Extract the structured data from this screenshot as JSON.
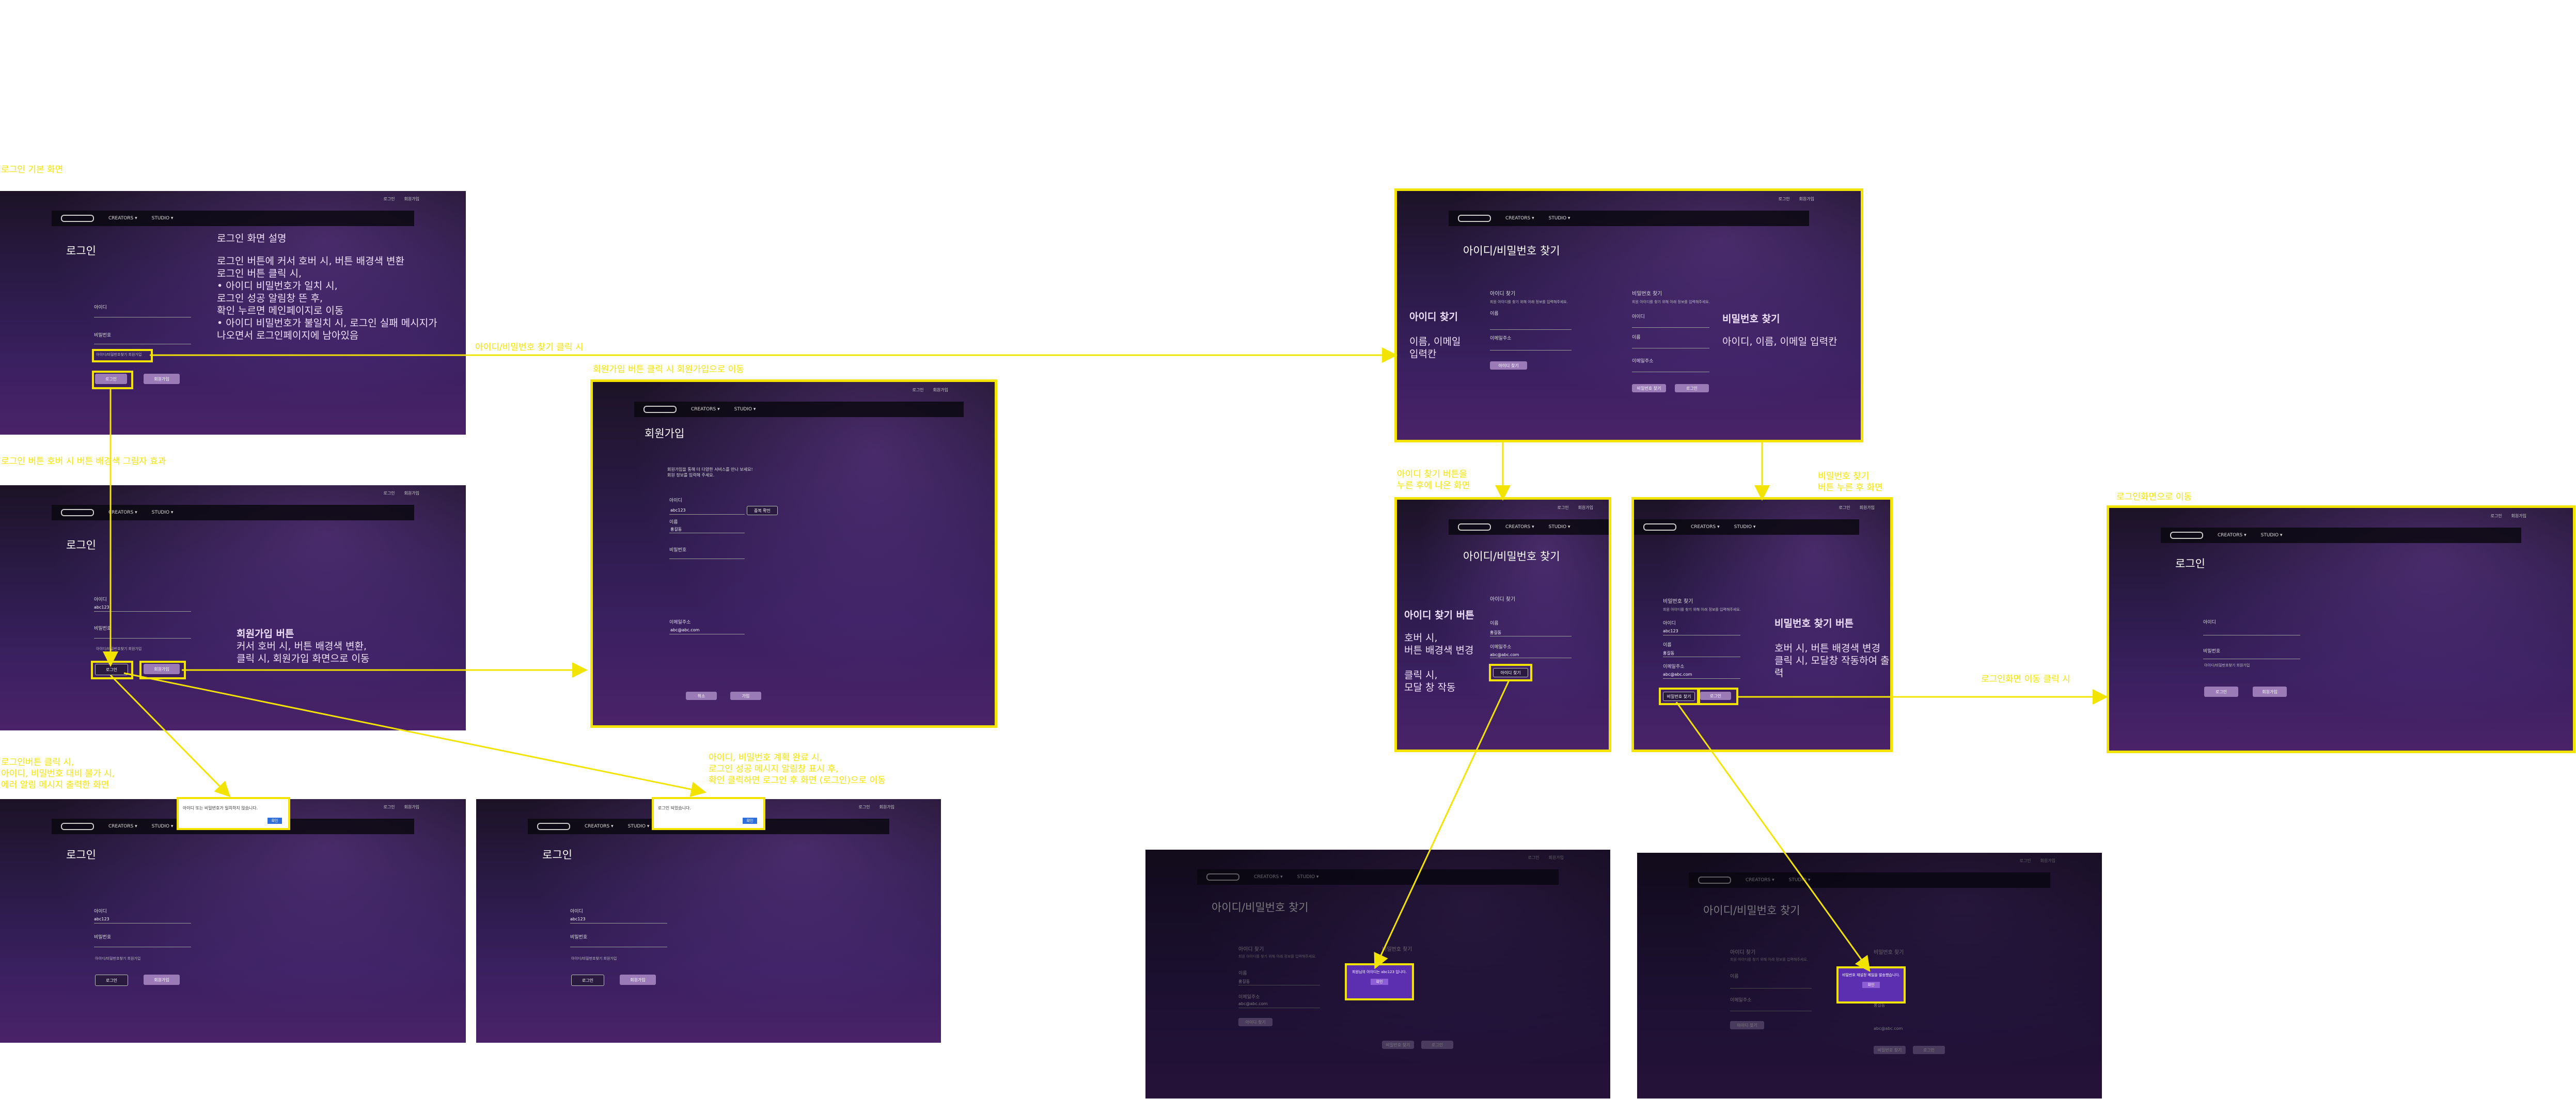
{
  "notes": {
    "login_default": "로그인 기본 화면",
    "login_hover": "로그인 버튼 호버 시 버튼 배경색 그림자 효과",
    "find_click": "아이디/비밀번호 찾기 클릭 시",
    "signup_click": "회원가입 버튼 클릭 시 회원가입으로 이동",
    "login_fail": "로그인버튼 클릭 시,\n아이디, 비밀번호 대비 불가 시,\n에러 알림 메시지 출력한 화면",
    "login_success": "아이디, 비밀번호 계획 완료 시,\n로그인 성공 메시지 알림창 표시 후,\n확인 클릭하면 로그인 후 화면 (로그인)으로 이동",
    "find_id_hover": "아이디 찾기 버튼을\n누른 후에 나온 화면",
    "find_pw_hover": "비밀번호 찾기\n버튼 누른 후 화면",
    "to_login_click": "로그인화면 이동 클릭 시",
    "to_login_screen": "로그인화면으로 이동"
  },
  "ui": {
    "util_login": "로그인",
    "util_signup": "회원가입",
    "nav_1": "CREATORS ▾",
    "nav_2": "STUDIO ▾",
    "login_title": "로그인",
    "signup_title": "회원가입",
    "find_title": "아이디/비밀번호 찾기",
    "id_label": "아이디",
    "pw_label": "비밀번호",
    "find_link": "아이디/비밀번호찾기 회원가입",
    "login_btn": "로그인",
    "signup_btn": "회원가입",
    "id_value": "abc123",
    "find_id_heading": "아이디 찾기",
    "find_pw_heading": "비밀번호 찾기",
    "find_desc": "회원 아이디를 찾기 위해 아래 정보를 입력해주세요.",
    "name_label": "이름",
    "email_label": "이메일주소",
    "find_id_btn": "아이디 찾기",
    "find_pw_btn": "비밀번호 찾기",
    "to_login_btn": "로그인",
    "name_value": "홍길동",
    "email_value": "abc@abc.com",
    "signup_desc": "회원가입을 통해 더 다양한 서비스를 만나 보세요!\n회원 정보를 입력해 주세요.",
    "check_btn": "중복 확인",
    "signup_cancel": "취소",
    "signup_submit": "가입",
    "alert_fail": "아이디 또는 비밀번호가 일치하지 않습니다.",
    "alert_success": "로그인 되었습니다.",
    "alert_ok": "확인",
    "modal_id": "회원님의 아이디는 abc123 입니다.",
    "modal_pw": "비밀번호 재설정 메일을 발송했습니다."
  },
  "desc": {
    "login_title": "로그인 화면 설명",
    "login_body": "로그인 버튼에 커서 호버 시, 버튼 배경색 변환\n로그인 버튼 클릭 시,\n • 아이디 비밀번호가 일치 시,\n   로그인 성공 알림창 뜬 후,\n   확인 누르면 메인페이지로 이동\n • 아이디 비밀번호가 불일치 시, 로그인 실패 메시지가\n   나오면서 로그인페이지에 남아있음",
    "signup_title": "회원가입 버튼",
    "signup_body": "커서 호버 시, 버튼 배경색 변환,\n클릭 시, 회원가입 화면으로 이동",
    "find_id_title": "아이디 찾기",
    "find_id_body": "이름, 이메일\n입력칸",
    "find_pw_title": "비밀번호 찾기",
    "find_pw_body": "아이디, 이름, 이메일 입력칸",
    "find_id_btn_title": "아이디 찾기 버튼",
    "find_id_btn_body": "호버 시,\n버튼 배경색 변경\n\n클릭 시,\n모달 창 작동",
    "find_pw_btn_title": "비밀번호 찾기 버튼",
    "find_pw_btn_body": "호버 시, 버튼 배경색 변경\n클릭 시, 모달창 작동하여 출력"
  },
  "colors": {
    "annotation": "#f2e400",
    "accent": "#9a7bb8",
    "page_bg": "#2a1a46"
  }
}
